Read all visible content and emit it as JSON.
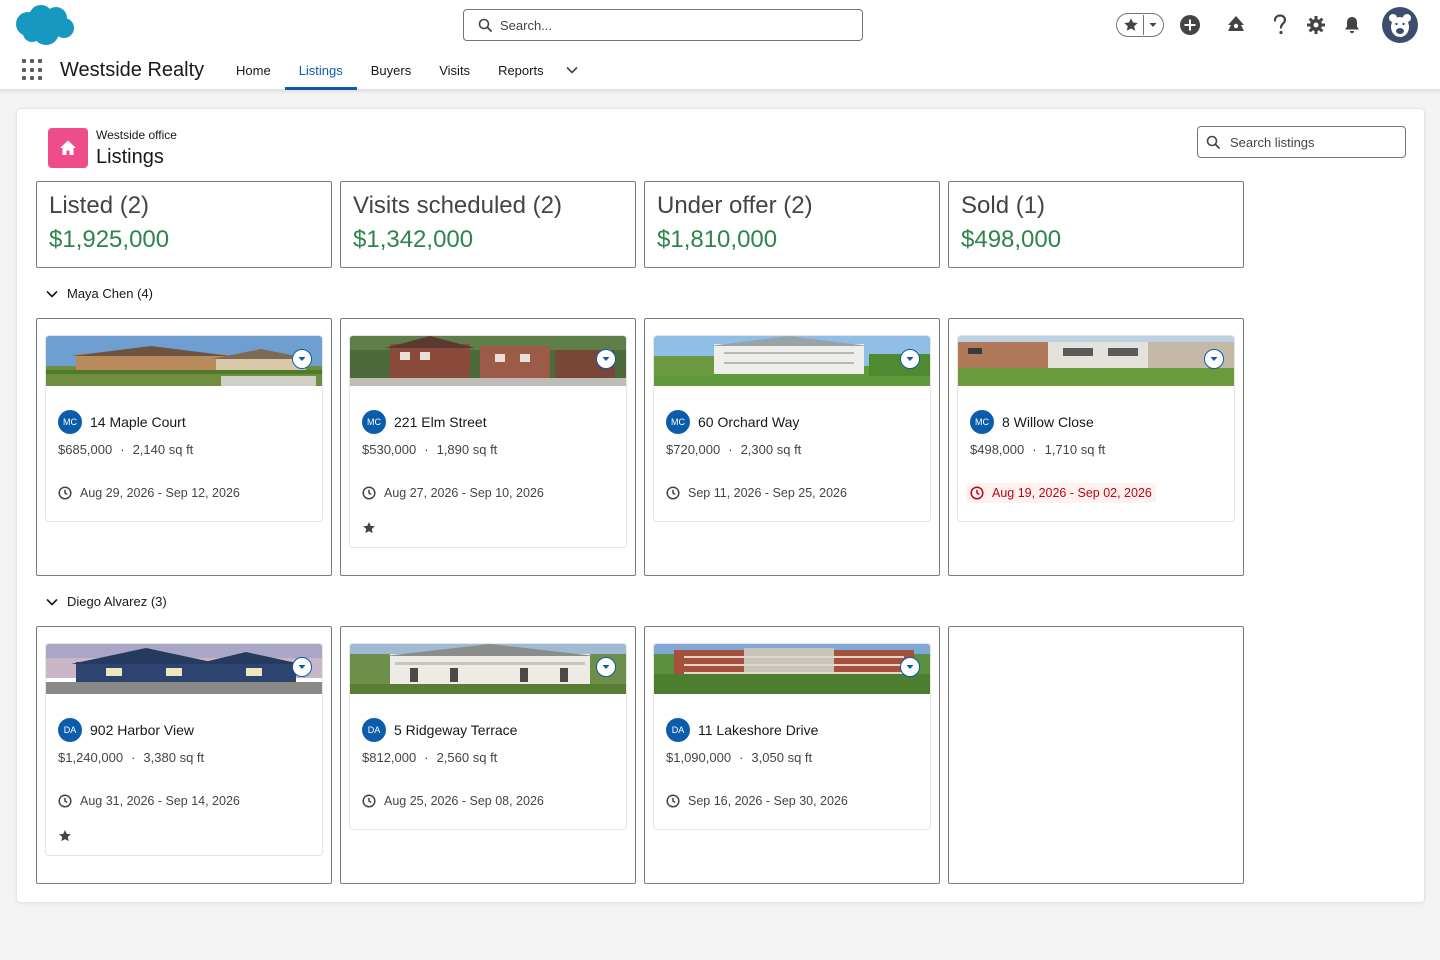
{
  "header": {
    "search_placeholder": "Search...",
    "icons": [
      "favorites-star-icon",
      "add-icon",
      "trailhead-icon",
      "help-icon",
      "setup-gear-icon",
      "notifications-bell-icon",
      "user-avatar"
    ]
  },
  "app": {
    "name": "Westside Realty",
    "nav": [
      {
        "label": "Home"
      },
      {
        "label": "Listings",
        "active": true
      },
      {
        "label": "Buyers"
      },
      {
        "label": "Visits"
      },
      {
        "label": "Reports"
      }
    ]
  },
  "page": {
    "subtitle": "Westside office",
    "title": "Listings",
    "search_placeholder": "Search listings"
  },
  "stages": [
    {
      "label": "Listed (2)",
      "amount": "$1,925,000"
    },
    {
      "label": "Visits scheduled (2)",
      "amount": "$1,342,000"
    },
    {
      "label": "Under offer (2)",
      "amount": "$1,810,000"
    },
    {
      "label": "Sold (1)",
      "amount": "$498,000"
    }
  ],
  "groups": [
    {
      "label": "Maya Chen (4)",
      "cards": [
        {
          "initials": "MC",
          "title": "14 Maple Court",
          "price": "$685,000",
          "size": "2,140 sq ft",
          "dates": "Aug 29, 2026 - Sep 12, 2026",
          "starred": false,
          "overdue": false
        },
        {
          "initials": "MC",
          "title": "221 Elm Street",
          "price": "$530,000",
          "size": "1,890 sq ft",
          "dates": "Aug 27, 2026 - Sep 10, 2026",
          "starred": true,
          "overdue": false
        },
        {
          "initials": "MC",
          "title": "60 Orchard Way",
          "price": "$720,000",
          "size": "2,300 sq ft",
          "dates": "Sep 11, 2026 - Sep 25, 2026",
          "starred": false,
          "overdue": false
        },
        {
          "initials": "MC",
          "title": "8 Willow Close",
          "price": "$498,000",
          "size": "1,710 sq ft",
          "dates": "Aug 19, 2026 - Sep 02, 2026",
          "starred": false,
          "overdue": true
        }
      ]
    },
    {
      "label": "Diego Alvarez (3)",
      "cards": [
        {
          "initials": "DA",
          "title": "902 Harbor View",
          "price": "$1,240,000",
          "size": "3,380 sq ft",
          "dates": "Aug 31, 2026 - Sep 14, 2026",
          "starred": true,
          "overdue": false
        },
        {
          "initials": "DA",
          "title": "5 Ridgeway Terrace",
          "price": "$812,000",
          "size": "2,560 sq ft",
          "dates": "Aug 25, 2026 - Sep 08, 2026",
          "starred": false,
          "overdue": false
        },
        {
          "initials": "DA",
          "title": "11 Lakeshore Drive",
          "price": "$1,090,000",
          "size": "3,050 sq ft",
          "dates": "Sep 16, 2026 - Sep 30, 2026",
          "starred": false,
          "overdue": false
        }
      ]
    }
  ],
  "colors": {
    "brand_blue": "#0b5cab",
    "amount_green": "#2e844a",
    "page_icon_pink": "#ef4c8b",
    "overdue_red": "#ba0517",
    "cloud_blue": "#1798c1"
  }
}
